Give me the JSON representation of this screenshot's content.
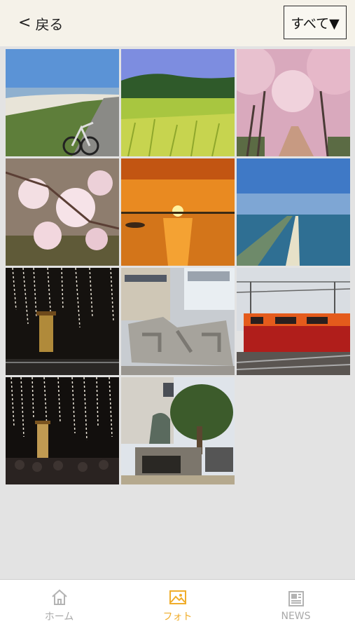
{
  "header": {
    "back_label": "戻る",
    "back_icon": "chevron-left-icon",
    "filter_label": "すべて▼"
  },
  "photos": [
    {
      "name": "photo-beach-bicycle"
    },
    {
      "name": "photo-rice-field"
    },
    {
      "name": "photo-cherry-blossom-avenue"
    },
    {
      "name": "photo-cherry-blossom-closeup"
    },
    {
      "name": "photo-ocean-sunset"
    },
    {
      "name": "photo-coastline-aerial"
    },
    {
      "name": "photo-fireworks-festival-night"
    },
    {
      "name": "photo-stone-monument-plaza"
    },
    {
      "name": "photo-red-train"
    },
    {
      "name": "photo-fireworks-shrine-crowd"
    },
    {
      "name": "photo-sumo-statue-pine"
    }
  ],
  "tabbar": {
    "tabs": [
      {
        "label": "ホーム",
        "icon": "home-icon",
        "active": false
      },
      {
        "label": "フォト",
        "icon": "photo-icon",
        "active": true
      },
      {
        "label": "NEWS",
        "icon": "news-icon",
        "active": false
      }
    ]
  },
  "colors": {
    "header_bg": "#f5f2e9",
    "grid_bg": "#e3e3e3",
    "active_tab": "#f0ad2b",
    "inactive_tab": "#a9a9a9"
  }
}
